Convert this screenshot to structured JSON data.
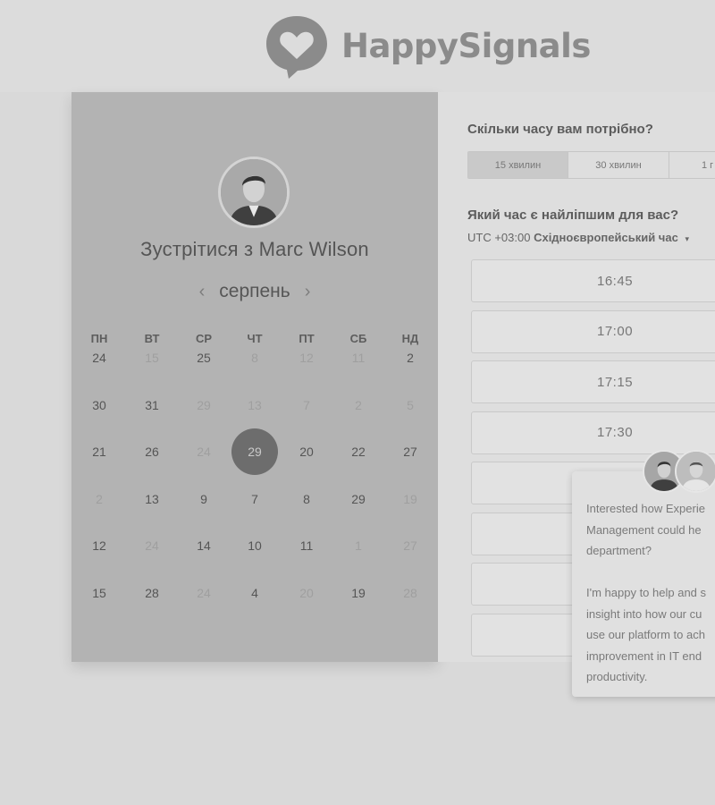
{
  "brand": {
    "name": "HappySignals",
    "logo_icon": "heart-chat-icon",
    "logo_color": "#8b8b8b"
  },
  "left": {
    "title": "Зустрітися з Marc Wilson",
    "month": "серпень",
    "prev_icon": "chevron-left-icon",
    "next_icon": "chevron-right-icon",
    "weekdays": [
      "ПН",
      "ВТ",
      "СР",
      "ЧТ",
      "ПТ",
      "СБ",
      "НД"
    ],
    "weeks": [
      [
        {
          "d": "24"
        },
        {
          "d": "15",
          "muted": true
        },
        {
          "d": "25"
        },
        {
          "d": "8",
          "muted": true
        },
        {
          "d": "12",
          "muted": true
        },
        {
          "d": "11",
          "muted": true
        },
        {
          "d": "2"
        }
      ],
      [
        {
          "d": "30"
        },
        {
          "d": "31"
        },
        {
          "d": "29",
          "muted": true
        },
        {
          "d": "13",
          "muted": true
        },
        {
          "d": "7",
          "muted": true
        },
        {
          "d": "2",
          "muted": true
        },
        {
          "d": "5",
          "muted": true
        }
      ],
      [
        {
          "d": "21"
        },
        {
          "d": "26"
        },
        {
          "d": "24",
          "muted": true
        },
        {
          "d": "29",
          "selected": true
        },
        {
          "d": "20"
        },
        {
          "d": "22"
        },
        {
          "d": "27"
        }
      ],
      [
        {
          "d": "2",
          "muted": true
        },
        {
          "d": "13"
        },
        {
          "d": "9"
        },
        {
          "d": "7"
        },
        {
          "d": "8"
        },
        {
          "d": "29"
        },
        {
          "d": "19",
          "muted": true
        }
      ],
      [
        {
          "d": "12"
        },
        {
          "d": "24",
          "muted": true
        },
        {
          "d": "14"
        },
        {
          "d": "10"
        },
        {
          "d": "11"
        },
        {
          "d": "1",
          "muted": true
        },
        {
          "d": "27",
          "muted": true
        }
      ],
      [
        {
          "d": "15"
        },
        {
          "d": "28"
        },
        {
          "d": "24",
          "muted": true
        },
        {
          "d": "4"
        },
        {
          "d": "20",
          "muted": true
        },
        {
          "d": "19"
        },
        {
          "d": "28",
          "muted": true
        }
      ]
    ],
    "selected_color": "#6d6d6d"
  },
  "right": {
    "duration_question": "Скільки часу вам потрібно?",
    "durations": [
      "15 хвилин",
      "30 хвилин",
      "1 г"
    ],
    "time_question": "Який час є найліпшим для вас?",
    "timezone_offset": "UTC +03:00",
    "timezone_name": "Східноєвропейський час",
    "timezone_caret": "▾",
    "slots": [
      "16:45",
      "17:00",
      "17:15",
      "17:30",
      "",
      "",
      "",
      ""
    ]
  },
  "chat": {
    "lines_1": [
      "Interested how Experie",
      "Management could he",
      "department?"
    ],
    "lines_2": [
      "I'm happy to help and s",
      "insight into how our cu",
      "use our platform to ach",
      "improvement in IT end",
      "productivity."
    ]
  }
}
